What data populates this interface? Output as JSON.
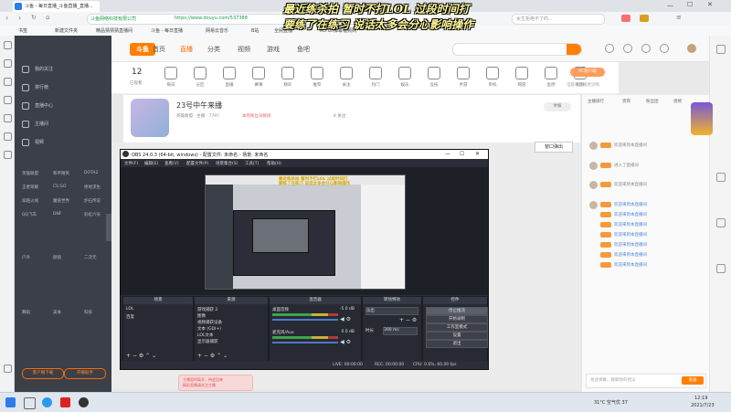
{
  "browser": {
    "tab_title": "斗鱼 - 每日直播_斗鱼直播_直播...",
    "url_secure_label": "斗鱼网络科技有限公司",
    "url": "https://www.douyu.com/537388",
    "bookmarks": [
      "书签",
      "新建文件夹",
      "精品猜猜猜直播间",
      "斗鱼 - 每日直播",
      "网易云音乐",
      "B站",
      "全民直播",
      "AcFun弹幕视频网"
    ],
    "search_placeholder": "女生拒绝不了的..."
  },
  "banner": {
    "line1": "最近练杀拍 暂时不打LOL 过段时间打",
    "line2": "要练了在练习 说话太多会分心影响操作"
  },
  "douyu_sidebar": {
    "items": [
      "我的关注",
      "排行榜",
      "直播中心",
      "主播间",
      "视频"
    ],
    "grid": [
      [
        "英雄联盟",
        "和平精英",
        "DOTA2"
      ],
      [
        "王者荣耀",
        "CS:GO",
        "绝地求生"
      ],
      [
        "穿越火线",
        "魔兽世界",
        "炉石传说"
      ],
      [
        "QQ飞车",
        "DNF",
        "彩虹六号"
      ],
      [
        "户外",
        "颜值",
        "二次元"
      ],
      [
        "舞蹈",
        "美食",
        "科技"
      ]
    ],
    "bottom_buttons": [
      "客户端下载",
      "开播助手"
    ]
  },
  "topnav": {
    "logo": "斗鱼",
    "items": [
      "首页",
      "直播",
      "分类",
      "视频",
      "游戏",
      "鱼吧"
    ],
    "active": "直播"
  },
  "categories": {
    "count": "12",
    "count_label": "已观看",
    "items": [
      "每日",
      "分区",
      "直播",
      "赛事",
      "精彩",
      "推荐",
      "关注",
      "热门",
      "娱乐",
      "竞技",
      "手游",
      "单机",
      "网游",
      "鱼吧",
      "视频"
    ],
    "pc_button": "PC客户端",
    "pc_sub": "电脑看直播更流畅"
  },
  "room": {
    "title": "23号中午来播",
    "meta1": "英雄联盟 · 主播 · 7797",
    "meta2": "本周粉丝贡献榜",
    "meta3": "4 关注",
    "report": "举报"
  },
  "right_panel": {
    "tabs": [
      "主播排行",
      "贵宾",
      "粉丝团",
      "周榜"
    ],
    "chats": [
      {
        "text": "欢迎来到本直播间",
        "blue": false
      },
      {
        "text": "进入了直播间",
        "blue": false
      },
      {
        "text": "欢迎来到本直播间",
        "blue": false
      },
      {
        "text": "欢迎来到本直播间",
        "blue": true
      },
      {
        "text": "欢迎来到本直播间",
        "blue": true
      },
      {
        "text": "欢迎来到本直播间",
        "blue": true
      },
      {
        "text": "欢迎来到本直播间",
        "blue": true
      },
      {
        "text": "欢迎来到本直播间",
        "blue": true
      },
      {
        "text": "欢迎来到本直播间",
        "blue": true
      },
      {
        "text": "欢迎来到本直播间",
        "blue": true
      }
    ],
    "chat_placeholder": "发送弹幕，聊聊你的想法",
    "send": "发送"
  },
  "float_button": "窗口弹出",
  "obs": {
    "title": "OBS 24.0.3 (64-bit, windows) - 配置文件: 未命名 - 场景: 未命名",
    "menu": [
      "文件(F)",
      "编辑(E)",
      "查看(V)",
      "配置文件(P)",
      "场景集合(S)",
      "工具(T)",
      "帮助(H)"
    ],
    "preview_line1": "最近练杀拍 暂时不打LOL 过段时间打",
    "preview_line2": "要练了在练习 说话太多会分心影响操作",
    "scenes_title": "场景",
    "scenes": [
      "LOL",
      "百度"
    ],
    "sources_title": "来源",
    "sources": [
      "游戏捕获 2",
      "图像",
      "视频捕获设备",
      "文本 (GDI+)",
      "LOL文本",
      "显示器捕获"
    ],
    "mixer_title": "混音器",
    "mixer": [
      {
        "name": "桌面音频",
        "db": "-5.0 dB"
      },
      {
        "name": "麦克风/Aux",
        "db": "0.0 dB"
      }
    ],
    "transitions_title": "转场特效",
    "transition": "淡出",
    "duration_label": "时长",
    "duration": "300 ms",
    "controls_title": "控件",
    "controls": [
      "停止推流",
      "开始录制",
      "工作室模式",
      "设置",
      "退出"
    ],
    "status": {
      "live": "LIVE: 00:00:00",
      "rec": "REC: 00:00:00",
      "cpu": "CPU: 0.6%, 60.00 fps"
    }
  },
  "taskbar": {
    "weather": "31°C 空气优 37",
    "time": "12:19",
    "date": "2021/7/23"
  },
  "toast": {
    "line1": "主播暂时离开，待会回来",
    "line2": "精彩直播请关注主播"
  }
}
